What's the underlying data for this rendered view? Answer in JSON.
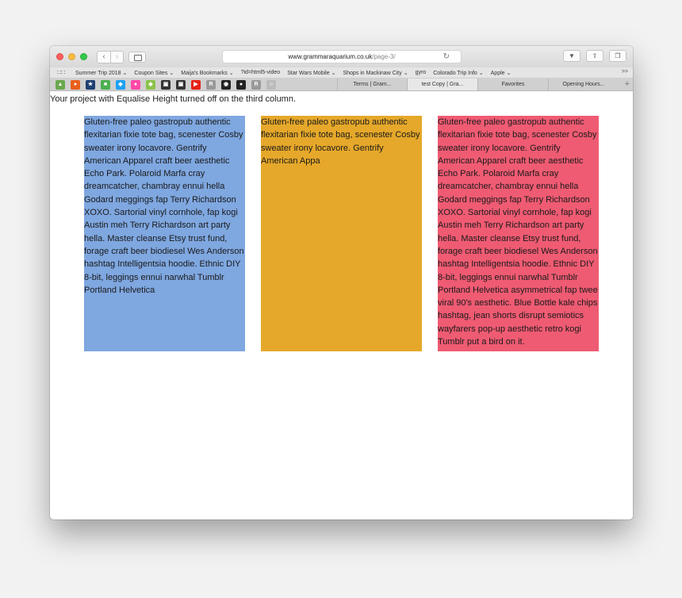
{
  "browser": {
    "url_domain": "www.grammaraquarium.co.uk",
    "url_path": "/page-3/",
    "bookmarks": [
      "Summer Trip 2018 ⌄",
      "Coupon Sites ⌄",
      "Maija's Bookmarks ⌄",
      "?id=html5-video",
      "Star Wars Mobile ⌄",
      "Shops in Mackinaw City ⌄",
      "gyro",
      "Colorado Trip Info ⌄",
      "Apple ⌄"
    ],
    "more": ">>",
    "tabs": [
      "Terms | Gram...",
      "test Copy | Gra...",
      "Favorites",
      "Opening Hours..."
    ],
    "add_tab": "+",
    "icons": [
      "shield-icon",
      "firefox-icon",
      "star-icon",
      "evernote-icon",
      "twitter-icon",
      "flickr-icon",
      "dropbox-icon",
      "boxed-icon",
      "boxed-icon",
      "youtube-icon",
      "r-icon",
      "github-icon",
      "pinterest-icon",
      "r-icon",
      "panda-icon"
    ]
  },
  "page": {
    "note": "Your project with Equalise Height turned off on the third column.",
    "columns": [
      {
        "text": "Gluten-free paleo gastropub authentic flexitarian fixie tote bag, scenester Cosby sweater irony locavore. Gentrify American Apparel craft beer aesthetic Echo Park. Polaroid Marfa cray dreamcatcher, chambray ennui hella Godard meggings fap Terry Richardson XOXO. Sartorial vinyl cornhole, fap kogi Austin meh Terry Richardson art party hella. Master cleanse Etsy trust fund, forage craft beer biodiesel Wes Anderson hashtag Intelligentsia hoodie. Ethnic DIY 8-bit, leggings ennui narwhal Tumblr Portland Helvetica",
        "color": "#7fa7e0"
      },
      {
        "text": "Gluten-free paleo gastropub authentic flexitarian fixie tote bag, scenester Cosby sweater irony locavore. Gentrify American Appa",
        "color": "#e6a82a"
      },
      {
        "text": "Gluten-free paleo gastropub authentic flexitarian fixie tote bag, scenester Cosby sweater irony locavore. Gentrify American Apparel craft beer aesthetic Echo Park. Polaroid Marfa cray dreamcatcher, chambray ennui hella Godard meggings fap Terry Richardson XOXO. Sartorial vinyl cornhole, fap kogi Austin meh Terry Richardson art party hella. Master cleanse Etsy trust fund, forage craft beer biodiesel Wes Anderson hashtag Intelligentsia hoodie. Ethnic DIY 8-bit, leggings ennui narwhal Tumblr Portland Helvetica asymmetrical fap twee viral 90's aesthetic. Blue Bottle kale chips hashtag, jean shorts disrupt semiotics wayfarers pop-up aesthetic retro kogi Tumblr put a bird on it.",
        "color": "#ef5b72"
      }
    ]
  }
}
